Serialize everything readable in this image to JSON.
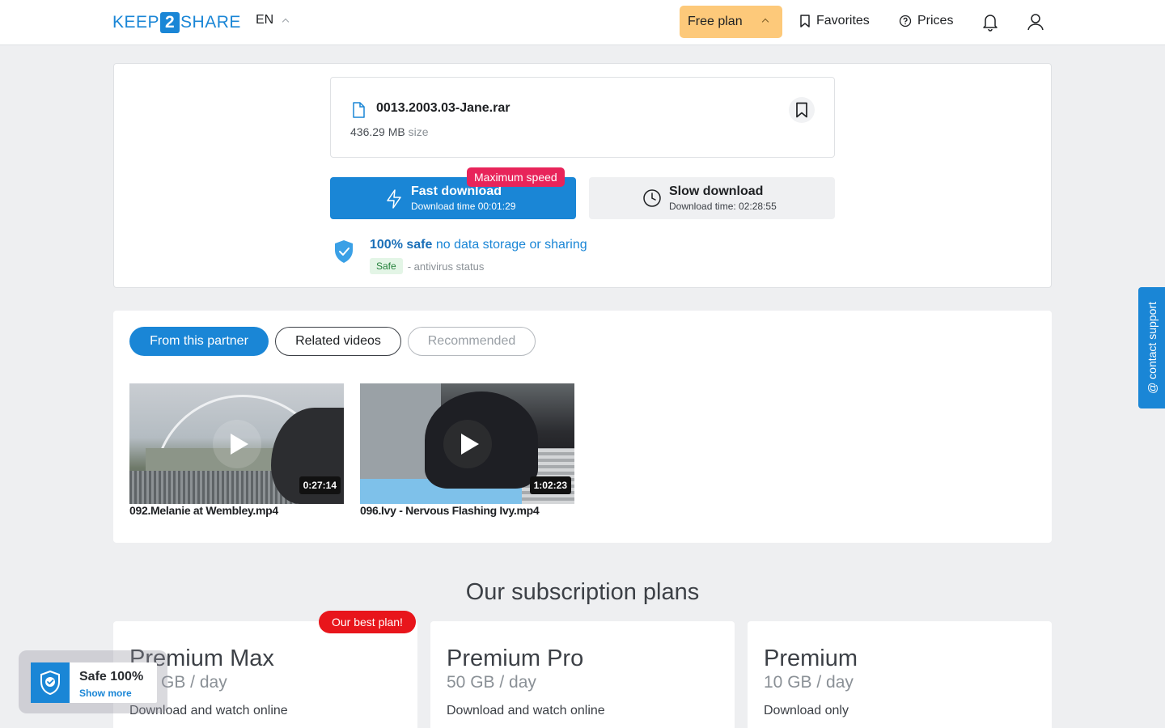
{
  "header": {
    "logo_left": "KEEP",
    "logo_mid": "2",
    "logo_right": "SHARE",
    "lang": "EN",
    "plan_button": "Free plan",
    "favorites": "Favorites",
    "prices": "Prices"
  },
  "file": {
    "name": "0013.2003.03-Jane.rar",
    "size_value": "436.29 MB",
    "size_unit": "size"
  },
  "download": {
    "badge": "Maximum speed",
    "fast_title": "Fast download",
    "fast_time": "Download time 00:01:29",
    "slow_title": "Slow download",
    "slow_time": "Download time: 02:28:55"
  },
  "safety": {
    "safe_bold": "100% safe",
    "safe_rest": "no data storage or sharing",
    "tag": "Safe",
    "status": "- antivirus status"
  },
  "tabs": {
    "partner": "From this partner",
    "related": "Related videos",
    "recommended": "Recommended"
  },
  "videos": [
    {
      "title": "092.Melanie at Wembley.mp4",
      "duration": "0:27:14"
    },
    {
      "title": "096.Ivy - Nervous Flashing Ivy.mp4",
      "duration": "1:02:23"
    }
  ],
  "plans": {
    "heading": "Our subscription plans",
    "best_badge": "Our best plan!",
    "items": [
      {
        "name": "Premium Max",
        "quota": "GB / day",
        "desc": "Download and watch online"
      },
      {
        "name": "Premium Pro",
        "quota": "50 GB / day",
        "desc": "Download and watch online"
      },
      {
        "name": "Premium",
        "quota": "10 GB / day",
        "desc": "Download only"
      }
    ]
  },
  "support": {
    "label": "@ contact support"
  },
  "safe_widget": {
    "title": "Safe 100%",
    "link": "Show more"
  },
  "colors": {
    "accent": "#1a86d6",
    "plan_button": "#fdc97a",
    "badge_red": "#e8245a"
  }
}
